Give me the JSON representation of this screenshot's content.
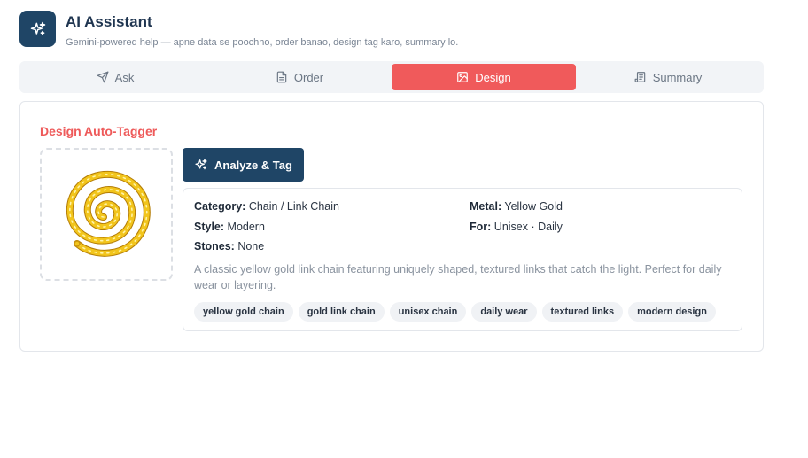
{
  "header": {
    "title": "AI Assistant",
    "subtitle": "Gemini-powered help — apne data se poochho, order banao, design tag karo, summary lo.",
    "icon": "sparkles-icon"
  },
  "tabs": [
    {
      "label": "Ask",
      "icon": "send-icon",
      "active": false
    },
    {
      "label": "Order",
      "icon": "document-icon",
      "active": false
    },
    {
      "label": "Design",
      "icon": "image-icon",
      "active": true
    },
    {
      "label": "Summary",
      "icon": "scroll-icon",
      "active": false
    }
  ],
  "design": {
    "title": "Design Auto-Tagger",
    "analyze_label": "Analyze & Tag",
    "fields": {
      "category": {
        "label": "Category:",
        "value": "Chain / Link Chain"
      },
      "metal": {
        "label": "Metal:",
        "value": "Yellow Gold"
      },
      "style": {
        "label": "Style:",
        "value": "Modern"
      },
      "for": {
        "label": "For:",
        "value": "Unisex · Daily"
      },
      "stones": {
        "label": "Stones:",
        "value": "None"
      }
    },
    "description": "A classic yellow gold link chain featuring uniquely shaped, textured links that catch the light. Perfect for daily wear or layering.",
    "tags": [
      "yellow gold chain",
      "gold link chain",
      "unisex chain",
      "daily wear",
      "textured links",
      "modern design"
    ]
  },
  "colors": {
    "primary": "#1f4566",
    "accent": "#f05a5b",
    "gold": "#e8b418"
  }
}
